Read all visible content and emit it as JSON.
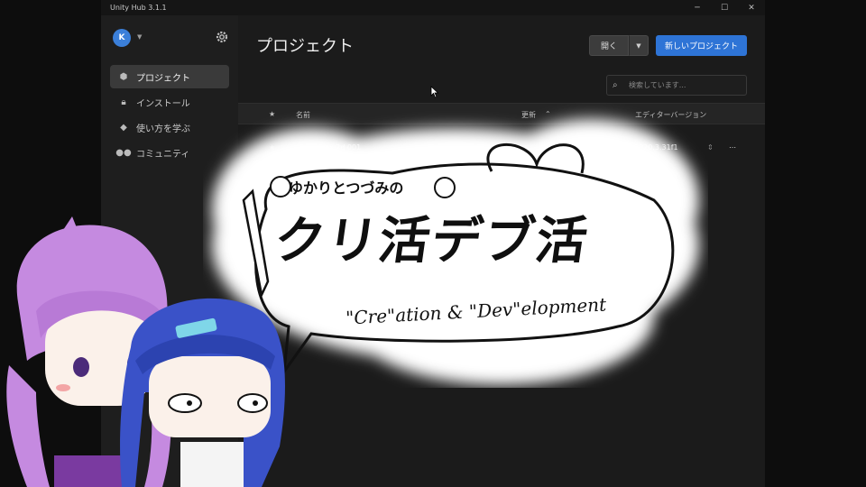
{
  "window": {
    "title": "Unity Hub 3.1.1",
    "controls": [
      "─",
      "☐",
      "✕"
    ]
  },
  "sidebar": {
    "avatar_initial": "K",
    "items": [
      {
        "label": "プロジェクト",
        "icon": "cube-icon",
        "active": true
      },
      {
        "label": "インストール",
        "icon": "lock-icon",
        "active": false
      },
      {
        "label": "使い方を学ぶ",
        "icon": "graduation-cap-icon",
        "active": false
      },
      {
        "label": "コミュニティ",
        "icon": "people-icon",
        "active": false
      }
    ]
  },
  "main": {
    "title": "プロジェクト",
    "open_label": "開く",
    "new_project_label": "新しいプロジェクト",
    "search_placeholder": "検索しています...",
    "columns": {
      "name": "名前",
      "modified": "更新",
      "editor_version": "エディターバージョン"
    },
    "rows": [
      {
        "name": "—sandbox 2d 001",
        "editor_version": "2020.3.31f1"
      }
    ]
  },
  "overlay": {
    "logo_line1": "ゆかりとつづみの",
    "logo_line2": "クリ活デブ活",
    "logo_line3": "\"Cre\"ation & \"Dev\"elopment"
  },
  "colors": {
    "accent": "#2e74d6",
    "window_bg": "#1e1e1e",
    "sidebar_active": "#3a3a3a"
  }
}
